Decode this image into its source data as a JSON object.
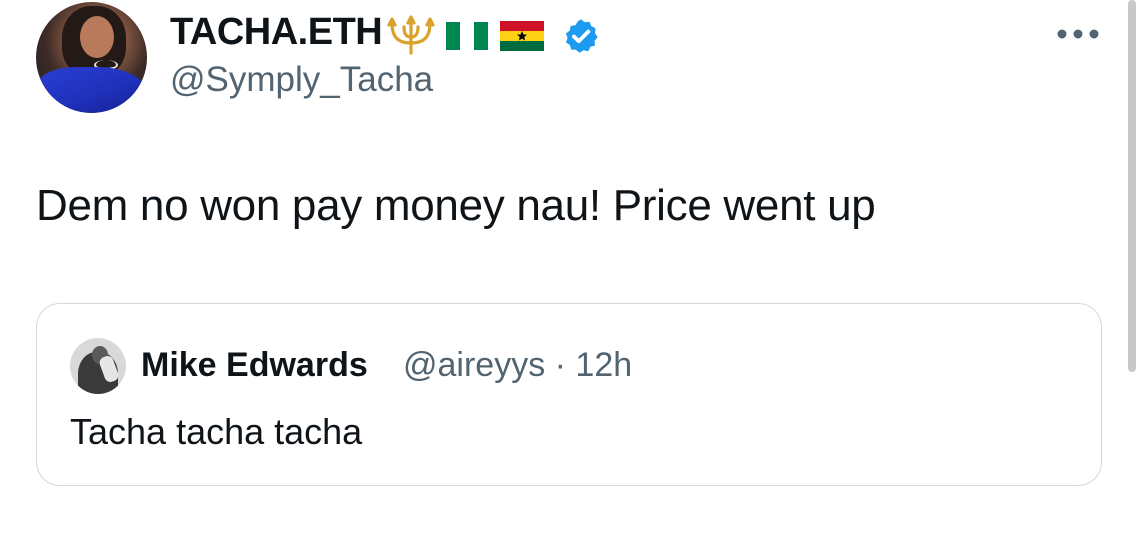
{
  "author": {
    "display_name": "TACHA.ETH",
    "handle": "@Symply_Tacha",
    "badges": [
      "trident-icon",
      "nigeria-flag-icon",
      "ghana-flag-icon",
      "verified-icon"
    ]
  },
  "tweet": {
    "text": "Dem no won pay money nau! Price went up"
  },
  "quoted_tweet": {
    "display_name": "Mike Edwards",
    "handle_time": "@aireyys · 12h",
    "text": "Tacha tacha tacha"
  },
  "icons": {
    "more": "more-options-icon"
  },
  "colors": {
    "text_primary": "#0f1419",
    "text_secondary": "#536471",
    "verified_blue": "#1d9bf0",
    "border": "#cfd9de",
    "trident_gold": "#d9a22b",
    "nigeria_green": "#008751",
    "ghana_red": "#ce1126",
    "ghana_yellow": "#fcd116",
    "ghana_green": "#006b3f"
  }
}
